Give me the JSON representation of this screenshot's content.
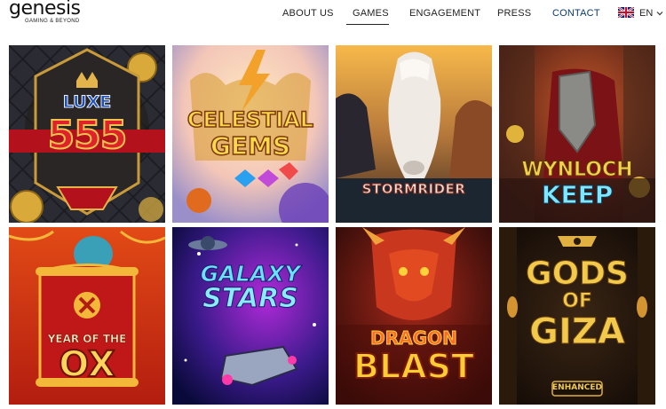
{
  "brand": {
    "name": "genesis",
    "tagline": "GAMING & BEYOND"
  },
  "nav": {
    "about": "ABOUT US",
    "games": "GAMES",
    "engagement": "ENGAGEMENT",
    "press": "PRESS",
    "contact": "CONTACT",
    "language": "EN",
    "active": "games"
  },
  "games": [
    {
      "name": "Luxe 555",
      "line1": "LUXE",
      "line2": "555"
    },
    {
      "name": "Celestial Gems",
      "line1": "CELESTIAL",
      "line2": "GEMS"
    },
    {
      "name": "Stormrider",
      "line1": "STORMRIDER"
    },
    {
      "name": "Wynloch Keep",
      "line1": "WYNLOCH",
      "line2": "KEEP"
    },
    {
      "name": "Year of the Ox",
      "line1": "YEAR OF THE",
      "line2": "OX"
    },
    {
      "name": "Galaxy Stars",
      "line1": "GALAXY",
      "line2": "STARS"
    },
    {
      "name": "Dragon Blast",
      "line1": "DRAGON",
      "line2": "BLAST"
    },
    {
      "name": "Gods of Giza Enhanced",
      "line1": "GODS",
      "line2": "OF",
      "line3": "GIZA",
      "line4": "ENHANCED"
    }
  ],
  "colors": {
    "nav_text": "#222222",
    "contact": "#0a3a6e",
    "accent_gold": "#e9b23a"
  }
}
